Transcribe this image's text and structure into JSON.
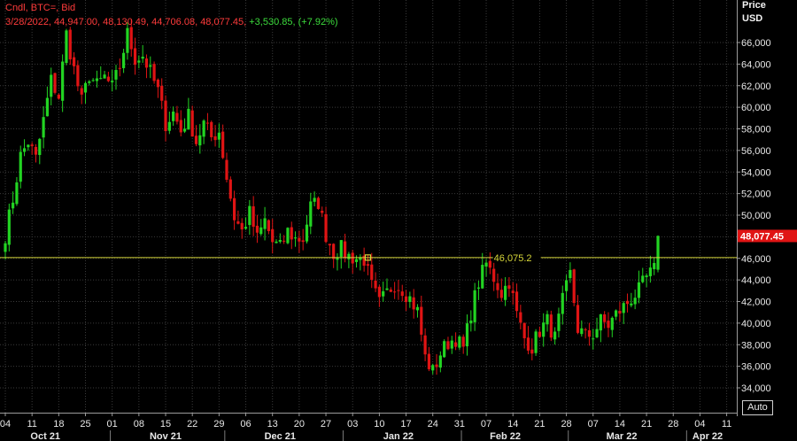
{
  "header": {
    "line1": "Cndl, BTC=, Bid",
    "line2_ohlc": "3/28/2022, 44,947.00, 48,130.49, 44,706.08, 48,077.45, ",
    "line2_change": "+3,530.85, (+7.92%)"
  },
  "axis": {
    "price_label": "Price",
    "currency_label": "USD",
    "auto_label": "Auto"
  },
  "colors": {
    "up": "#22d422",
    "down": "#e01414",
    "hline": "#d6d639",
    "grid": "#3a3a3a",
    "bg": "#000000",
    "last_price_bg": "#e01414"
  },
  "chart_data": {
    "type": "candlestick",
    "title": "Cndl, BTC=, Bid",
    "ylabel": "Price USD",
    "ylim": [
      32600,
      68600
    ],
    "xlim": [
      0,
      184
    ],
    "y_ticks": [
      34000,
      36000,
      38000,
      40000,
      42000,
      44000,
      46000,
      48000,
      50000,
      52000,
      54000,
      56000,
      58000,
      60000,
      62000,
      64000,
      66000
    ],
    "y_tick_labels": [
      "34,000",
      "36,000",
      "38,000",
      "40,000",
      "42,000",
      "44,000",
      "46,000",
      "48,000",
      "50,000",
      "52,000",
      "54,000",
      "56,000",
      "58,000",
      "60,000",
      "62,000",
      "64,000",
      "66,000"
    ],
    "x_ticks": [
      {
        "x": 0,
        "label": "04"
      },
      {
        "x": 7,
        "label": "11"
      },
      {
        "x": 14,
        "label": "18"
      },
      {
        "x": 21,
        "label": "25"
      },
      {
        "x": 28,
        "label": "01"
      },
      {
        "x": 35,
        "label": "08"
      },
      {
        "x": 42,
        "label": "15"
      },
      {
        "x": 49,
        "label": "22"
      },
      {
        "x": 56,
        "label": "29"
      },
      {
        "x": 63,
        "label": "06"
      },
      {
        "x": 70,
        "label": "13"
      },
      {
        "x": 77,
        "label": "20"
      },
      {
        "x": 84,
        "label": "27"
      },
      {
        "x": 91,
        "label": "03"
      },
      {
        "x": 98,
        "label": "10"
      },
      {
        "x": 105,
        "label": "17"
      },
      {
        "x": 112,
        "label": "24"
      },
      {
        "x": 119,
        "label": "31"
      },
      {
        "x": 126,
        "label": "07"
      },
      {
        "x": 133,
        "label": "14"
      },
      {
        "x": 140,
        "label": "21"
      },
      {
        "x": 147,
        "label": "28"
      },
      {
        "x": 154,
        "label": "07"
      },
      {
        "x": 161,
        "label": "14"
      },
      {
        "x": 168,
        "label": "21"
      },
      {
        "x": 175,
        "label": "28"
      },
      {
        "x": 182,
        "label": "04"
      },
      {
        "x": 189,
        "label": "11"
      }
    ],
    "months": [
      {
        "x": 10.5,
        "label": "Oct 21"
      },
      {
        "x": 42,
        "label": "Nov 21"
      },
      {
        "x": 72,
        "label": "Dec 21"
      },
      {
        "x": 103,
        "label": "Jan 22"
      },
      {
        "x": 131,
        "label": "Feb 22"
      },
      {
        "x": 161.5,
        "label": "Mar 22"
      },
      {
        "x": 184,
        "label": "Apr 22"
      }
    ],
    "month_boundaries": [
      27.5,
      57.5,
      88.5,
      119.5,
      147.5,
      178.5
    ],
    "horizontal_line": {
      "value": 46075.2,
      "label": "46,075.2"
    },
    "last_price": {
      "value": 48077.45,
      "label": "48,077.45"
    },
    "anchors": [
      [
        0,
        48200
      ],
      [
        2,
        51500
      ],
      [
        4,
        55500
      ],
      [
        6,
        56800
      ],
      [
        8,
        55200
      ],
      [
        10,
        58800
      ],
      [
        12,
        62500
      ],
      [
        14,
        61000
      ],
      [
        16,
        66800
      ],
      [
        18,
        63500
      ],
      [
        20,
        60500
      ],
      [
        22,
        63000
      ],
      [
        24,
        62000
      ],
      [
        26,
        62800
      ],
      [
        28,
        61800
      ],
      [
        30,
        63800
      ],
      [
        32,
        66800
      ],
      [
        34,
        64500
      ],
      [
        36,
        64800
      ],
      [
        38,
        63200
      ],
      [
        40,
        61500
      ],
      [
        42,
        58500
      ],
      [
        44,
        59500
      ],
      [
        46,
        57800
      ],
      [
        48,
        59200
      ],
      [
        50,
        56800
      ],
      [
        52,
        58500
      ],
      [
        54,
        57200
      ],
      [
        56,
        57800
      ],
      [
        58,
        53500
      ],
      [
        60,
        49800
      ],
      [
        62,
        48500
      ],
      [
        64,
        50200
      ],
      [
        66,
        47800
      ],
      [
        68,
        49500
      ],
      [
        70,
        47500
      ],
      [
        72,
        47000
      ],
      [
        74,
        48500
      ],
      [
        76,
        47800
      ],
      [
        78,
        47800
      ],
      [
        80,
        50800
      ],
      [
        82,
        51200
      ],
      [
        84,
        48200
      ],
      [
        86,
        46500
      ],
      [
        88,
        46900
      ],
      [
        90,
        46200
      ],
      [
        92,
        46000
      ],
      [
        94,
        45900
      ],
      [
        96,
        43400
      ],
      [
        98,
        41800
      ],
      [
        100,
        42800
      ],
      [
        102,
        43700
      ],
      [
        104,
        43200
      ],
      [
        106,
        42300
      ],
      [
        108,
        41100
      ],
      [
        110,
        36800
      ],
      [
        112,
        35500
      ],
      [
        114,
        37200
      ],
      [
        116,
        38200
      ],
      [
        118,
        38600
      ],
      [
        120,
        37600
      ],
      [
        122,
        41000
      ],
      [
        124,
        43800
      ],
      [
        126,
        45500
      ],
      [
        128,
        44200
      ],
      [
        130,
        42800
      ],
      [
        132,
        43900
      ],
      [
        134,
        40800
      ],
      [
        136,
        38600
      ],
      [
        138,
        37800
      ],
      [
        140,
        39300
      ],
      [
        142,
        40200
      ],
      [
        144,
        38600
      ],
      [
        146,
        42000
      ],
      [
        148,
        44500
      ],
      [
        150,
        39500
      ],
      [
        152,
        38800
      ],
      [
        154,
        39000
      ],
      [
        156,
        40200
      ],
      [
        158,
        39800
      ],
      [
        160,
        40800
      ],
      [
        162,
        41500
      ],
      [
        164,
        42300
      ],
      [
        166,
        43000
      ],
      [
        168,
        44200
      ],
      [
        170,
        44900
      ],
      [
        171,
        48077
      ]
    ],
    "seed": 7
  }
}
